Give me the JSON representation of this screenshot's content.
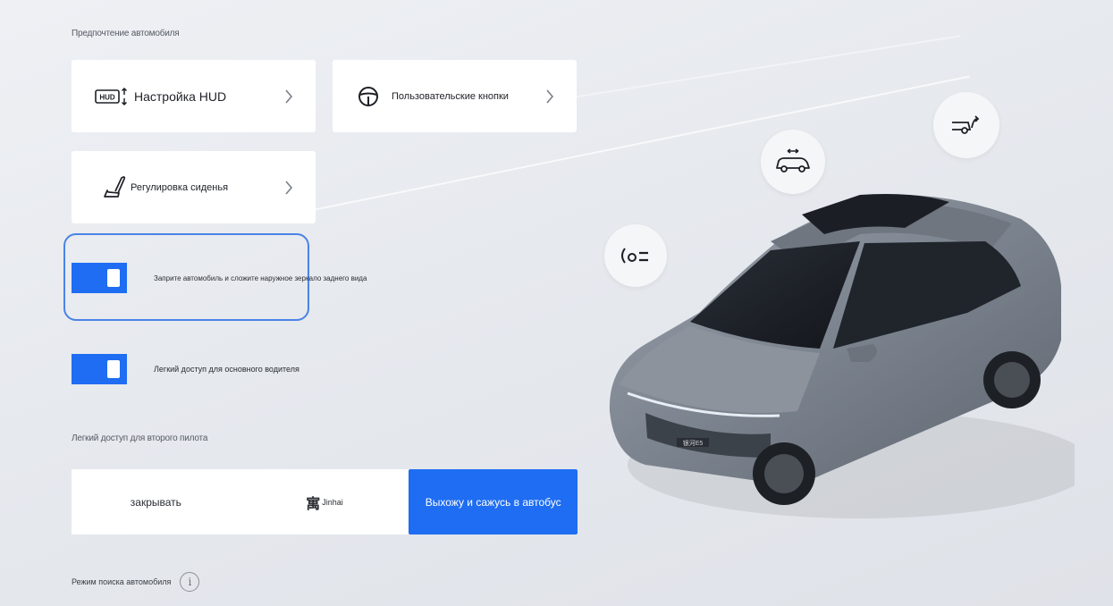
{
  "section_vehicle": "Предпочтение автомобиля",
  "cards": {
    "hud": {
      "icon_badge": "HUD",
      "label": "Настройка HUD"
    },
    "custom_buttons": {
      "label": "Пользовательские кнопки"
    },
    "seat": {
      "label": "Регулировка сиденья"
    }
  },
  "toggles": {
    "mirror_fold": {
      "label": "Заприте автомобиль и сложите наружное зеркало заднего вида",
      "on": true
    },
    "easy_access_driver": {
      "label": "Легкий доступ для основного водителя",
      "on": true
    }
  },
  "copilot": {
    "title": "Легкий доступ для второго пилота",
    "options": [
      {
        "label": "закрывать",
        "active": false
      },
      {
        "glyph": "寓",
        "label": "Jinhai",
        "active": false
      },
      {
        "label": "Выхожу и сажусь в автобус",
        "active": true
      }
    ]
  },
  "car_search": {
    "label": "Режим поиска автомобиля",
    "info_glyph": "i"
  },
  "car_badge": "银河E5",
  "colors": {
    "accent": "#1f6df2",
    "focus": "#4a83e6",
    "car_body": "#7d8591"
  }
}
